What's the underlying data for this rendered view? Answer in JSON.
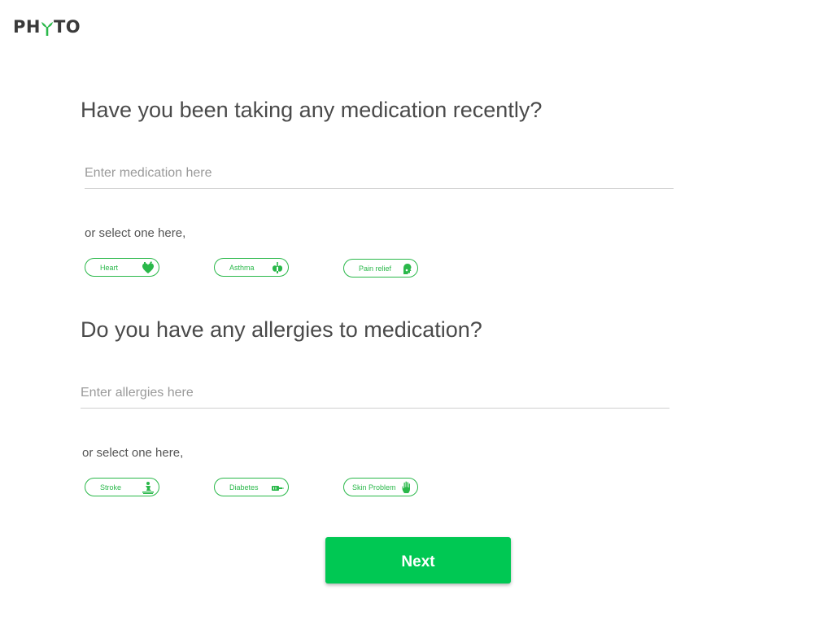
{
  "brand": {
    "logo_text_left": "PH",
    "logo_text_right": "TO",
    "accent_color": "#2ab84a",
    "button_color": "#00c853"
  },
  "medication": {
    "question": "Have you been taking any medication recently?",
    "placeholder": "Enter medication here",
    "value": "",
    "select_label": "or select one here,",
    "options": [
      {
        "label": "Heart",
        "icon": "heart-icon"
      },
      {
        "label": "Asthma",
        "icon": "lungs-icon"
      },
      {
        "label": "Pain relief",
        "icon": "pain-relief-icon"
      }
    ]
  },
  "allergies": {
    "question": "Do you have any allergies to medication?",
    "placeholder": "Enter allergies here",
    "value": "",
    "select_label": "or select one here,",
    "options": [
      {
        "label": "Stroke",
        "icon": "stroke-icon"
      },
      {
        "label": "Diabetes",
        "icon": "syringe-icon"
      },
      {
        "label": "Skin Problem",
        "icon": "hand-icon"
      }
    ]
  },
  "actions": {
    "next_label": "Next"
  }
}
